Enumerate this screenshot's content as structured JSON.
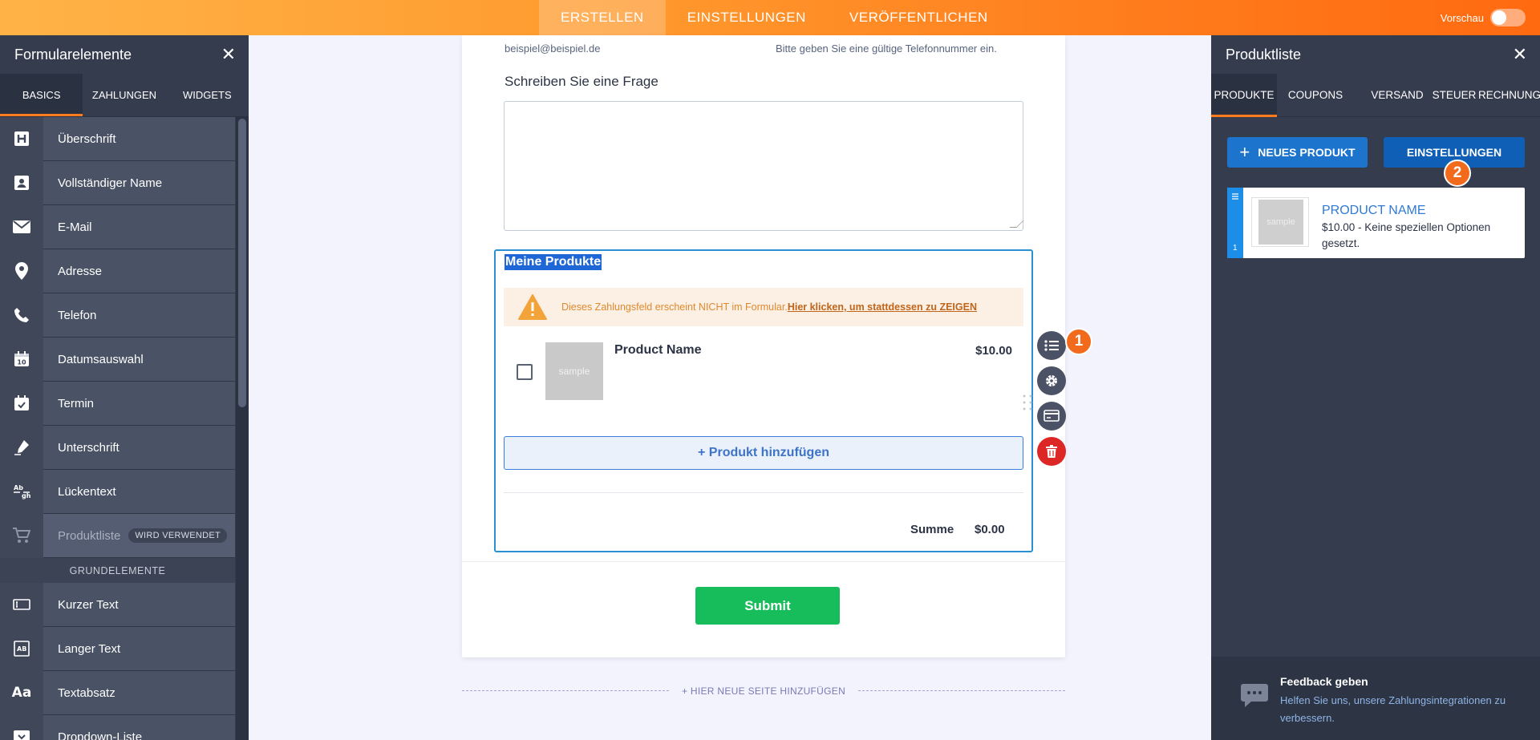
{
  "topbar": {
    "tabs": [
      {
        "label": "ERSTELLEN",
        "active": true
      },
      {
        "label": "EINSTELLUNGEN",
        "active": false
      },
      {
        "label": "VERÖFFENTLICHEN",
        "active": false
      }
    ],
    "preview_label": "Vorschau",
    "preview_on": false
  },
  "left_panel": {
    "title": "Formularelemente",
    "tabs": [
      {
        "label": "BASICS",
        "active": true
      },
      {
        "label": "ZAHLUNGEN",
        "active": false
      },
      {
        "label": "WIDGETS",
        "active": false
      }
    ],
    "items": [
      {
        "label": "Überschrift",
        "icon": "heading-icon"
      },
      {
        "label": "Vollständiger Name",
        "icon": "user-card-icon"
      },
      {
        "label": "E-Mail",
        "icon": "envelope-icon"
      },
      {
        "label": "Adresse",
        "icon": "map-pin-icon"
      },
      {
        "label": "Telefon",
        "icon": "phone-icon"
      },
      {
        "label": "Datumsauswahl",
        "icon": "calendar-icon"
      },
      {
        "label": "Termin",
        "icon": "calendar-check-icon"
      },
      {
        "label": "Unterschrift",
        "icon": "pen-icon"
      },
      {
        "label": "Lückentext",
        "icon": "fill-blank-icon"
      },
      {
        "label": "Produktliste",
        "icon": "cart-icon",
        "badge": "WIRD VERWENDET"
      }
    ],
    "section_label": "GRUNDELEMENTE",
    "items2": [
      {
        "label": "Kurzer Text",
        "icon": "short-text-icon"
      },
      {
        "label": "Langer Text",
        "icon": "long-text-icon"
      },
      {
        "label": "Textabsatz",
        "icon": "paragraph-icon"
      },
      {
        "label": "Dropdown-Liste",
        "icon": "dropdown-icon"
      }
    ]
  },
  "form": {
    "email_sublabel": "beispiel@beispiel.de",
    "phone_sublabel": "Bitte geben Sie eine gültige Telefonnummer ein.",
    "question_label": "Schreiben Sie eine Frage",
    "question_value": "",
    "product_block": {
      "title": "Meine Produkte",
      "warning_text": "Dieses Zahlungsfeld erscheint NICHT im Formular.",
      "warning_link": "Hier klicken, um stattdessen zu ZEIGEN",
      "product": {
        "name": "Product Name",
        "price": "$10.00",
        "thumb_text": "sample",
        "checked": false
      },
      "add_button": "+ Produkt hinzufügen",
      "sum_label": "Summe",
      "sum_value": "$0.00"
    },
    "submit_label": "Submit",
    "new_page_label": "+ HIER NEUE SEITE HINZUFÜGEN"
  },
  "tools": {
    "badge1": "1",
    "badge2": "2"
  },
  "right_panel": {
    "title": "Produktliste",
    "tabs": [
      {
        "label": "PRODUKTE",
        "active": true
      },
      {
        "label": "COUPONS",
        "active": false
      },
      {
        "label": "VERSAND",
        "active": false
      },
      {
        "label": "STEUER",
        "active": false
      },
      {
        "label": "RECHNUNG",
        "active": false
      }
    ],
    "new_product_button": "NEUES PRODUKT",
    "settings_button": "EINSTELLUNGEN",
    "product_card": {
      "index": "1",
      "thumb_text": "sample",
      "name": "PRODUCT NAME",
      "description": "$10.00 - Keine speziellen Optionen gesetzt."
    },
    "feedback_title": "Feedback geben",
    "feedback_text": "Helfen Sie uns, unsere Zahlungsintegrationen zu verbessern."
  },
  "colors": {
    "accent_orange": "#ff7b1c",
    "panel_dark": "#343c4e",
    "primary_blue": "#1c74cc",
    "submit_green": "#18bd5b",
    "delete_red": "#dd2626"
  }
}
